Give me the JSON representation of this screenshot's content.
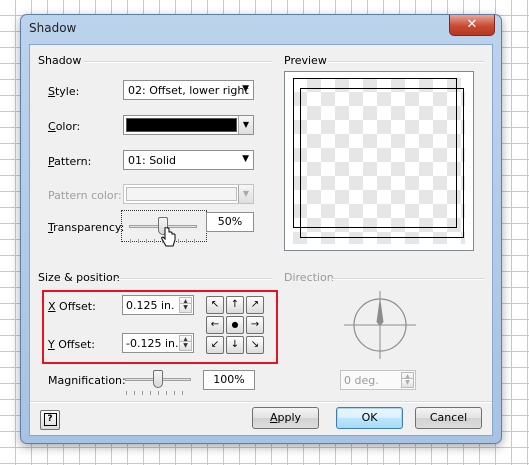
{
  "window": {
    "title": "Shadow",
    "close_glyph": "✕"
  },
  "shadow": {
    "header": "Shadow",
    "style": {
      "mnemonic": "S",
      "rest": "tyle:",
      "value": "02: Offset, lower right"
    },
    "color": {
      "mnemonic": "C",
      "rest": "olor:",
      "value_color": "#000000"
    },
    "pattern": {
      "mnemonic": "P",
      "rest": "attern:",
      "value": "01: Solid"
    },
    "pattern_color": {
      "label": "Pattern color:",
      "enabled": false
    },
    "transparency": {
      "mnemonic": "T",
      "rest": "ransparency:",
      "value": "50%",
      "level": 0.5
    }
  },
  "preview": {
    "header": "Preview"
  },
  "size_position": {
    "header": "Size & position",
    "x_offset": {
      "mnemonic": "X",
      "rest": " Offset:",
      "value": "0.125 in."
    },
    "y_offset": {
      "mnemonic": "Y",
      "rest": " Offset:",
      "value": "-0.125 in."
    },
    "magnification": {
      "label": "Magnification:",
      "value": "100%",
      "level": 0.5
    },
    "highlight_color": "#e0151f"
  },
  "direction": {
    "header": "Direction",
    "value": "0 deg.",
    "enabled": false
  },
  "buttons": {
    "help_glyph": "?",
    "apply": {
      "mnemonic": "A",
      "rest": "pply"
    },
    "ok": "OK",
    "cancel": "Cancel"
  },
  "arrow_pad": [
    "↖",
    "↑",
    "↗",
    "←",
    "●",
    "→",
    "↙",
    "↓",
    "↘"
  ]
}
